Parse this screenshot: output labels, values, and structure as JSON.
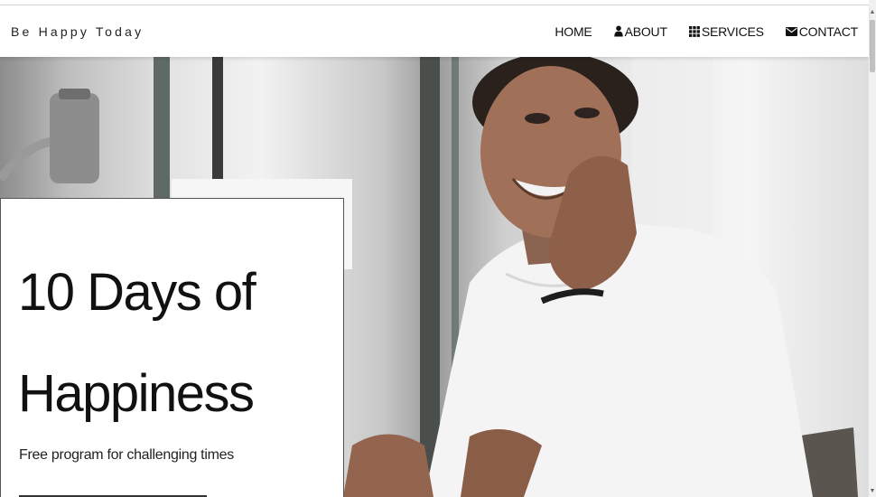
{
  "navbar": {
    "brand": "Be Happy Today",
    "links": [
      {
        "label": "HOME",
        "icon": "none"
      },
      {
        "label": "ABOUT",
        "icon": "user-icon"
      },
      {
        "label": "SERVICES",
        "icon": "grid-icon"
      },
      {
        "label": "CONTACT",
        "icon": "envelope-icon"
      }
    ]
  },
  "hero": {
    "image_subject": "smiling woman at desk",
    "title_line1": "10 Days of",
    "title_line2": "Happiness",
    "subtitle": "Free program for challenging times"
  },
  "scrollbar": {
    "up": "▲",
    "down": "▼"
  }
}
